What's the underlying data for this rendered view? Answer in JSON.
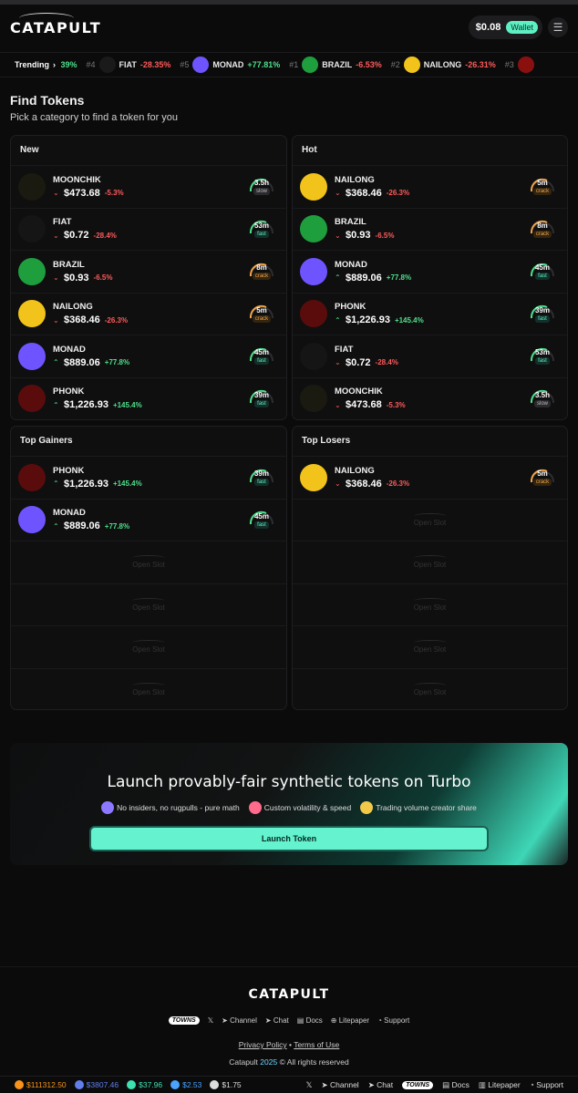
{
  "header": {
    "logo": "CATAPULT",
    "balance": "$0.08",
    "wallet_label": "Wallet",
    "menu_icon": "menu-icon"
  },
  "trending": {
    "label": "Trending",
    "items": [
      {
        "rank": "",
        "name": "",
        "change": "5.39%",
        "dir": "up",
        "color": "#444444"
      },
      {
        "rank": "#4",
        "name": "FIAT",
        "change": "-28.35%",
        "dir": "down",
        "color": "#1a1a1a"
      },
      {
        "rank": "#5",
        "name": "MONAD",
        "change": "+77.81%",
        "dir": "up",
        "color": "#6e54ff"
      },
      {
        "rank": "#1",
        "name": "BRAZIL",
        "change": "-6.53%",
        "dir": "down",
        "color": "#1f9e3e"
      },
      {
        "rank": "#2",
        "name": "NAILONG",
        "change": "-26.31%",
        "dir": "down",
        "color": "#f2c31a"
      },
      {
        "rank": "#3",
        "name": "",
        "change": "",
        "dir": "up",
        "color": "#8a1010"
      }
    ]
  },
  "page": {
    "title": "Find Tokens",
    "subtitle": "Pick a category to find a token for you"
  },
  "panels": {
    "new": {
      "title": "New",
      "rows": [
        {
          "name": "MOONCHIK",
          "price": "$473.68",
          "change": "-5.3%",
          "dir": "down",
          "time": "3.5h",
          "badge": "slow",
          "avatar": "#1a1a10"
        },
        {
          "name": "FIAT",
          "price": "$0.72",
          "change": "-28.4%",
          "dir": "down",
          "time": "53m",
          "badge": "fast",
          "avatar": "#151515"
        },
        {
          "name": "BRAZIL",
          "price": "$0.93",
          "change": "-6.5%",
          "dir": "down",
          "time": "8m",
          "badge": "crack",
          "avatar": "#1f9e3e"
        },
        {
          "name": "NAILONG",
          "price": "$368.46",
          "change": "-26.3%",
          "dir": "down",
          "time": "5m",
          "badge": "crack",
          "avatar": "#f2c31a"
        },
        {
          "name": "MONAD",
          "price": "$889.06",
          "change": "+77.8%",
          "dir": "up",
          "time": "45m",
          "badge": "fast",
          "avatar": "#6e54ff"
        },
        {
          "name": "PHONK",
          "price": "$1,226.93",
          "change": "+145.4%",
          "dir": "up",
          "time": "39m",
          "badge": "fast",
          "avatar": "#5a0c0c"
        }
      ]
    },
    "hot": {
      "title": "Hot",
      "rows": [
        {
          "name": "NAILONG",
          "price": "$368.46",
          "change": "-26.3%",
          "dir": "down",
          "time": "5m",
          "badge": "crack",
          "avatar": "#f2c31a"
        },
        {
          "name": "BRAZIL",
          "price": "$0.93",
          "change": "-6.5%",
          "dir": "down",
          "time": "8m",
          "badge": "crack",
          "avatar": "#1f9e3e"
        },
        {
          "name": "MONAD",
          "price": "$889.06",
          "change": "+77.8%",
          "dir": "up",
          "time": "45m",
          "badge": "fast",
          "avatar": "#6e54ff"
        },
        {
          "name": "PHONK",
          "price": "$1,226.93",
          "change": "+145.4%",
          "dir": "up",
          "time": "39m",
          "badge": "fast",
          "avatar": "#5a0c0c"
        },
        {
          "name": "FIAT",
          "price": "$0.72",
          "change": "-28.4%",
          "dir": "down",
          "time": "53m",
          "badge": "fast",
          "avatar": "#151515"
        },
        {
          "name": "MOONCHIK",
          "price": "$473.68",
          "change": "-5.3%",
          "dir": "down",
          "time": "3.5h",
          "badge": "slow",
          "avatar": "#1a1a10"
        }
      ]
    },
    "gainers": {
      "title": "Top Gainers",
      "rows": [
        {
          "name": "PHONK",
          "price": "$1,226.93",
          "change": "+145.4%",
          "dir": "up",
          "time": "39m",
          "badge": "fast",
          "avatar": "#5a0c0c"
        },
        {
          "name": "MONAD",
          "price": "$889.06",
          "change": "+77.8%",
          "dir": "up",
          "time": "45m",
          "badge": "fast",
          "avatar": "#6e54ff"
        }
      ],
      "slot_label": "Open Slot",
      "slots": 4
    },
    "losers": {
      "title": "Top Losers",
      "rows": [
        {
          "name": "NAILONG",
          "price": "$368.46",
          "change": "-26.3%",
          "dir": "down",
          "time": "5m",
          "badge": "crack",
          "avatar": "#f2c31a"
        }
      ],
      "slot_label": "Open Slot",
      "slots": 5
    }
  },
  "banner": {
    "title": "Launch provably-fair synthetic tokens on Turbo",
    "features": [
      {
        "icon": "clock-icon",
        "text": "No insiders, no rugpulls - pure math",
        "color": "#8d79ff"
      },
      {
        "icon": "flag-icon",
        "text": "Custom volatility & speed",
        "color": "#ff6b8a"
      },
      {
        "icon": "money-icon",
        "text": "Trading volume creator share",
        "color": "#f3c94a"
      }
    ],
    "button": "Launch Token"
  },
  "footer": {
    "logo": "CATAPULT",
    "links": {
      "towns": "TOWNS",
      "channel": "Channel",
      "chat": "Chat",
      "docs": "Docs",
      "litepaper": "Litepaper",
      "support": "Support"
    },
    "privacy": "Privacy Policy",
    "separator": "•",
    "terms": "Terms of Use",
    "copy_prefix": "Catapult",
    "year": "2025",
    "copy_suffix": "© All rights reserved"
  },
  "bottom_bar": {
    "tickers": [
      {
        "value": "$111312.50",
        "color": "#f7931a"
      },
      {
        "value": "$3807.46",
        "color": "#627eea"
      },
      {
        "value": "$37.96",
        "color": "#3de0b0"
      },
      {
        "value": "$2.53",
        "color": "#4aa3ff"
      },
      {
        "value": "$1.75",
        "color": "#dddddd"
      }
    ],
    "links": {
      "channel": "Channel",
      "chat": "Chat",
      "towns": "TOWNS",
      "docs": "Docs",
      "litepaper": "Litepaper",
      "support": "Support"
    }
  }
}
